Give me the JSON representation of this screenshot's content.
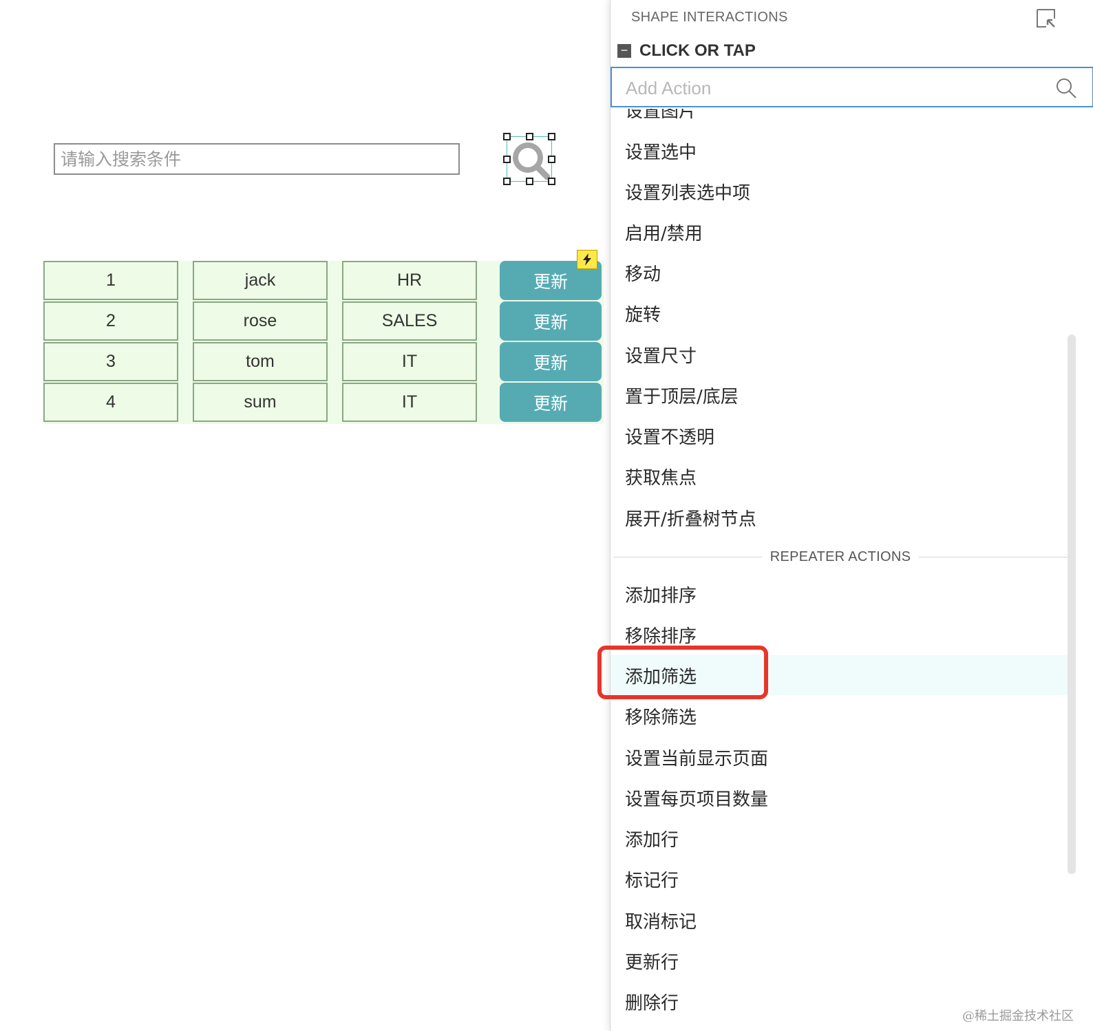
{
  "canvas": {
    "search_placeholder": "请输入搜索条件",
    "search_widget_icon": "magnifier-icon",
    "rows": [
      {
        "id": "1",
        "name": "jack",
        "dept": "HR",
        "button": "更新"
      },
      {
        "id": "2",
        "name": "rose",
        "dept": "SALES",
        "button": "更新"
      },
      {
        "id": "3",
        "name": "tom",
        "dept": "IT",
        "button": "更新"
      },
      {
        "id": "4",
        "name": "sum",
        "dept": "IT",
        "button": "更新"
      }
    ],
    "interaction_badge_icon": "lightning-icon"
  },
  "panel": {
    "title": "SHAPE INTERACTIONS",
    "popout_icon": "popout-icon",
    "event": {
      "collapse_symbol": "−",
      "label": "CLICK OR TAP"
    },
    "add_action_placeholder": "Add Action",
    "actions": [
      "设置图片",
      "设置选中",
      "设置列表选中项",
      "启用/禁用",
      "移动",
      "旋转",
      "设置尺寸",
      "置于顶层/底层",
      "设置不透明",
      "获取焦点",
      "展开/折叠树节点"
    ],
    "section_label": "REPEATER ACTIONS",
    "repeater_actions": [
      "添加排序",
      "移除排序",
      "添加筛选",
      "移除筛选",
      "设置当前显示页面",
      "设置每页项目数量",
      "添加行",
      "标记行",
      "取消标记",
      "更新行",
      "删除行"
    ],
    "highlighted_action": "添加筛选"
  },
  "watermark": "@稀土掘金技术社区",
  "colors": {
    "button_teal": "#56abb3",
    "cell_bg": "#eefbe6",
    "highlight_red": "#e8352a",
    "focus_blue": "#4a8fd3"
  }
}
